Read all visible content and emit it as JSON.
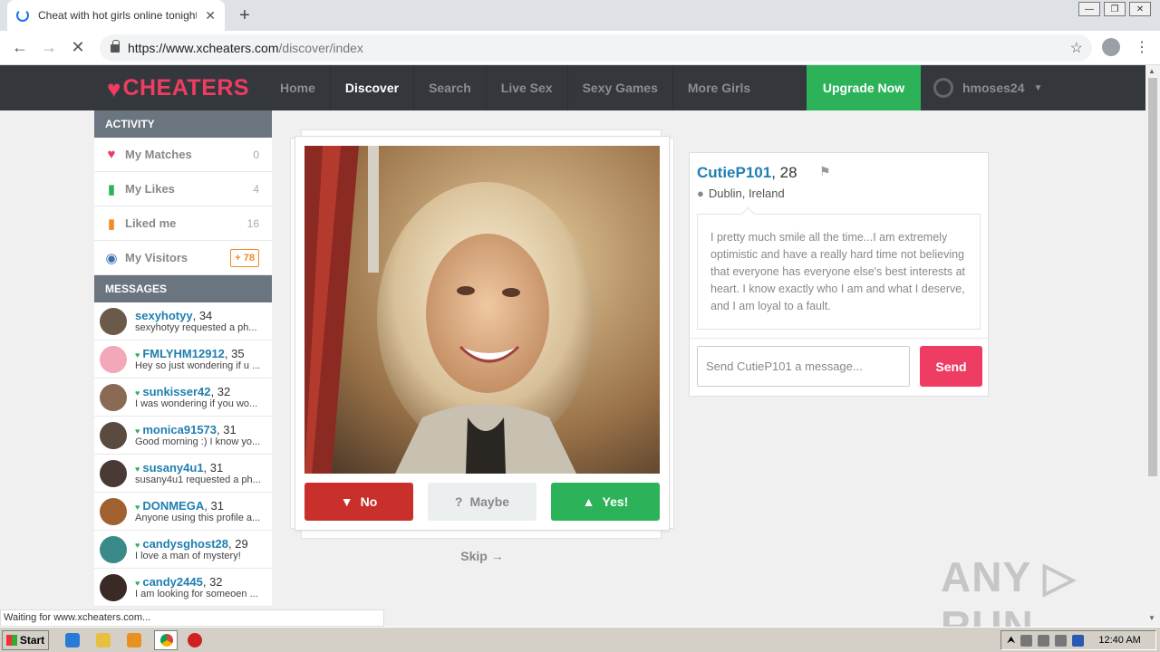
{
  "browser": {
    "tab_title": "Cheat with hot girls online tonight fo",
    "tab_close": "✕",
    "new_tab": "+",
    "url_host": "https://www.xcheaters.com",
    "url_path": "/discover/index",
    "status": "Waiting for www.xcheaters.com..."
  },
  "nav": {
    "logo": "CHEATERS",
    "links": [
      "Home",
      "Discover",
      "Search",
      "Live Sex",
      "Sexy Games",
      "More Girls"
    ],
    "active": "Discover",
    "upgrade": "Upgrade Now",
    "username": "hmoses24"
  },
  "activity": {
    "heading": "ACTIVITY",
    "items": [
      {
        "label": "My Matches",
        "count": "0",
        "icon": "heart-icon",
        "color": "#ee3c62"
      },
      {
        "label": "My Likes",
        "count": "4",
        "icon": "thumbs-up-icon",
        "color": "#2cb35a"
      },
      {
        "label": "Liked me",
        "count": "16",
        "icon": "hand-icon",
        "color": "#f08a24"
      },
      {
        "label": "My Visitors",
        "count": "+ 78",
        "icon": "eye-icon",
        "color": "#3a6fb0"
      }
    ]
  },
  "messages": {
    "heading": "MESSAGES",
    "items": [
      {
        "name": "sexyhotyy",
        "age": ", 34",
        "online": false,
        "preview": "sexyhotyy requested a ph...",
        "avatar": "#6b5a4a"
      },
      {
        "name": "FMLYHM12912",
        "age": ", 35",
        "online": true,
        "preview": "Hey so just wondering if u ...",
        "avatar": "#f2a8b8"
      },
      {
        "name": "sunkisser42",
        "age": ", 32",
        "online": true,
        "preview": "I was wondering if you wo...",
        "avatar": "#8a6a55"
      },
      {
        "name": "monica91573",
        "age": ", 31",
        "online": true,
        "preview": "Good morning :) I know yo...",
        "avatar": "#5a4a40"
      },
      {
        "name": "susany4u1",
        "age": ", 31",
        "online": true,
        "preview": "susany4u1 requested a ph...",
        "avatar": "#4a3a35"
      },
      {
        "name": "DONMEGA",
        "age": ", 31",
        "online": true,
        "preview": "Anyone using this profile a...",
        "avatar": "#a06030"
      },
      {
        "name": "candysghost28",
        "age": ", 29",
        "online": true,
        "preview": "I love a man of mystery!",
        "avatar": "#3a8a8a"
      },
      {
        "name": "candy2445",
        "age": ", 32",
        "online": true,
        "preview": "I am looking for someoen ...",
        "avatar": "#3a2a25"
      }
    ]
  },
  "vote": {
    "no": "No",
    "maybe": "Maybe",
    "yes": "Yes!",
    "skip": "Skip →"
  },
  "profile": {
    "name": "CutieP101",
    "age": ", 28",
    "location": "Dublin, Ireland",
    "bio": "I pretty much smile all the time...I am extremely optimistic and have a really hard time not believing that everyone has everyone else's best interests at heart. I know exactly who I am and what I deserve, and I am loyal to a fault.",
    "message_placeholder": "Send CutieP101 a message...",
    "send": "Send"
  },
  "watermark": "ANY ▷ RUN",
  "taskbar": {
    "start": "Start",
    "clock": "12:40 AM"
  }
}
